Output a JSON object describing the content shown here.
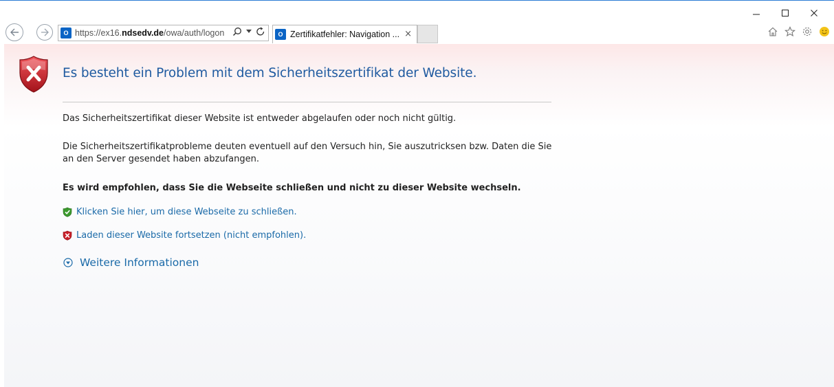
{
  "window": {
    "minimize_glyph": "–",
    "maximize_glyph": "☐",
    "close_glyph": "✕"
  },
  "toolbar": {
    "address": {
      "url_prefix": "https://ex16.",
      "url_domain": "ndsedv.de",
      "url_path": "/owa/auth/logon",
      "favicon": "outlook-icon"
    },
    "tab": {
      "title": "Zertifikatfehler: Navigation ...",
      "close_glyph": "×"
    },
    "right_icons": [
      "home-icon",
      "favorites-star-icon",
      "settings-gear-icon",
      "feedback-smiley-icon"
    ]
  },
  "page": {
    "title": "Es besteht ein Problem mit dem Sicherheitszertifikat der Website.",
    "paragraph1": "Das Sicherheitszertifikat dieser Website ist entweder abgelaufen oder noch nicht gültig.",
    "paragraph2": "Die Sicherheitszertifikatprobleme deuten eventuell auf den Versuch hin, Sie auszutricksen bzw. Daten die Sie an den Server gesendet haben abzufangen.",
    "recommendation": "Es wird empfohlen, dass Sie die Webseite schließen und nicht zu dieser Website wechseln.",
    "close_link": "Klicken Sie hier, um diese Webseite zu schließen.",
    "continue_link": "Laden dieser Website fortsetzen (nicht empfohlen).",
    "more_info": "Weitere Informationen"
  },
  "colors": {
    "accent_blue": "#1f5aa0",
    "link_blue": "#1a6aa8",
    "error_red": "#c8202a",
    "safe_green": "#3c9a2e"
  }
}
